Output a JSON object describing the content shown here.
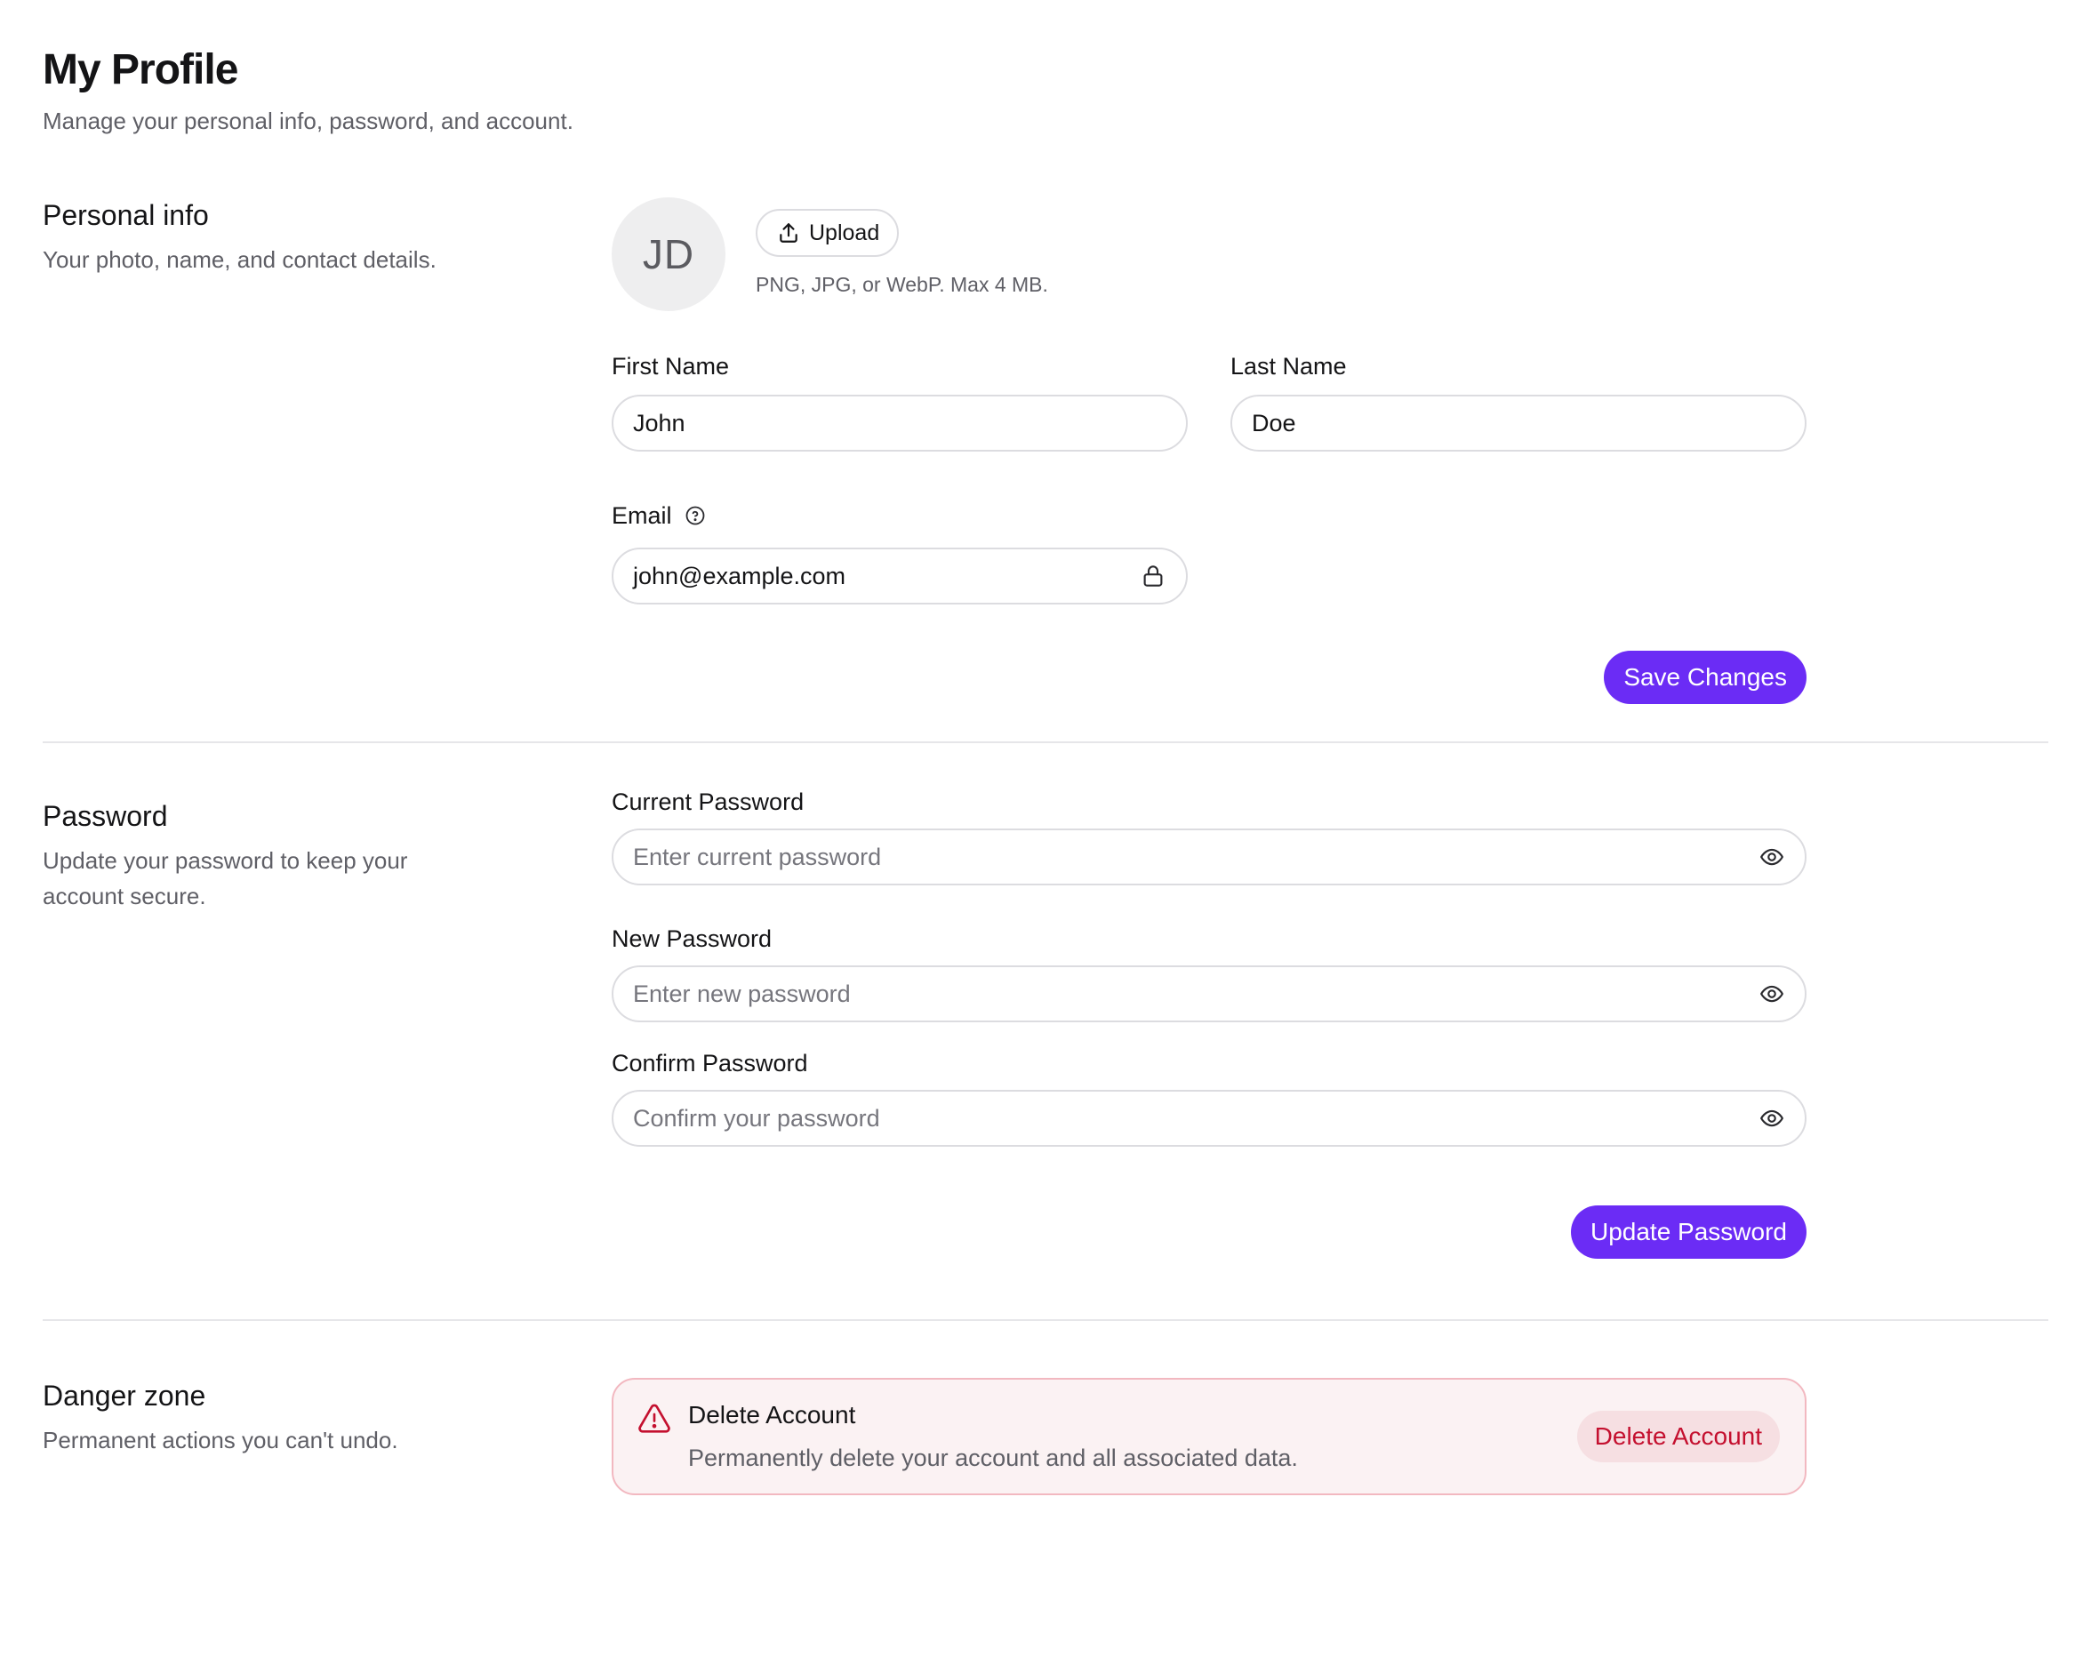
{
  "header": {
    "title": "My Profile",
    "subtitle": "Manage your personal info, password, and account."
  },
  "personal": {
    "title": "Personal info",
    "description": "Your photo, name, and contact details.",
    "avatar_initials": "JD",
    "upload_label": "Upload",
    "upload_hint": "PNG, JPG, or WebP. Max 4 MB.",
    "first_name_label": "First Name",
    "first_name_value": "John",
    "last_name_label": "Last Name",
    "last_name_value": "Doe",
    "email_label": "Email",
    "email_value": "john@example.com",
    "save_label": "Save Changes"
  },
  "password": {
    "title": "Password",
    "description": "Update your password to keep your account secure.",
    "current_label": "Current Password",
    "current_placeholder": "Enter current password",
    "new_label": "New Password",
    "new_placeholder": "Enter new password",
    "confirm_label": "Confirm Password",
    "confirm_placeholder": "Confirm your password",
    "update_label": "Update Password"
  },
  "danger": {
    "title": "Danger zone",
    "description": "Permanent actions you can't undo.",
    "card_title": "Delete Account",
    "card_description": "Permanently delete your account and all associated data.",
    "button_label": "Delete Account"
  },
  "colors": {
    "accent": "#6b2cf5",
    "danger": "#c4102f",
    "danger_bg": "#fbf2f3"
  },
  "icons": [
    "upload-icon",
    "help-circle-icon",
    "lock-icon",
    "eye-icon",
    "warning-triangle-icon"
  ]
}
